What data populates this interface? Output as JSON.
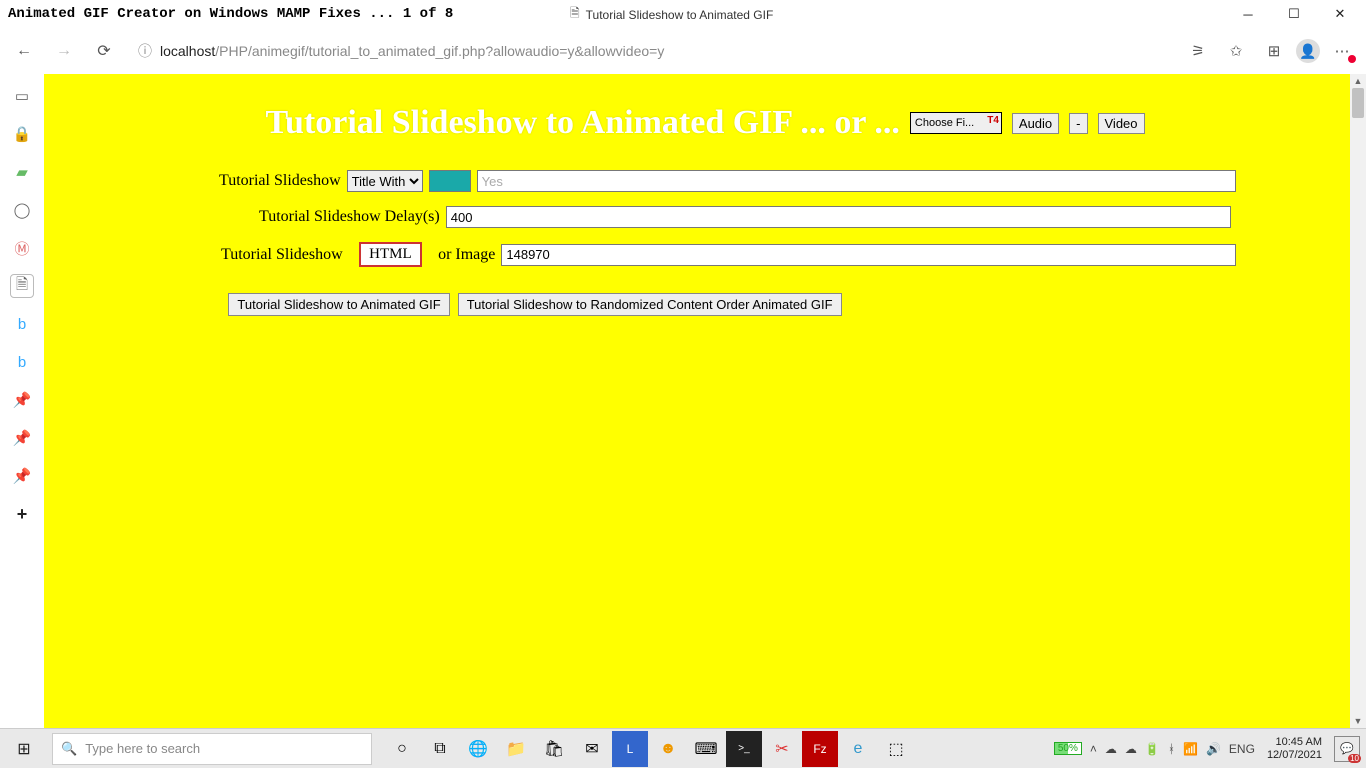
{
  "window": {
    "title": "Animated GIF Creator on Windows MAMP Fixes ... 1 of 8",
    "tab_title": "Tutorial Slideshow to Animated GIF"
  },
  "browser": {
    "url_host": "localhost",
    "url_path": "/PHP/animegif/tutorial_to_animated_gif.php?allowaudio=y&allowvideo=y"
  },
  "heading": {
    "text": "Tutorial Slideshow to Animated GIF ... or ...",
    "choose_file": "Choose Fi...",
    "audio_btn": "Audio",
    "minus_btn": "-",
    "video_btn": "Video"
  },
  "form": {
    "row1_label": "Tutorial Slideshow",
    "row1_select": "Title With",
    "row1_placeholder": "Yes",
    "row2_label": "Tutorial Slideshow Delay(s)",
    "row2_value": "400",
    "row3_label_a": "Tutorial Slideshow",
    "row3_html_btn": "HTML",
    "row3_label_b": "or Image",
    "row3_value": "148970",
    "btn1": "Tutorial Slideshow to Animated GIF",
    "btn2": "Tutorial Slideshow to Randomized Content Order Animated GIF"
  },
  "taskbar": {
    "search_placeholder": "Type here to search",
    "battery": "50%",
    "lang": "ENG",
    "time": "10:45 AM",
    "date": "12/07/2021",
    "notif_badge": "10"
  }
}
